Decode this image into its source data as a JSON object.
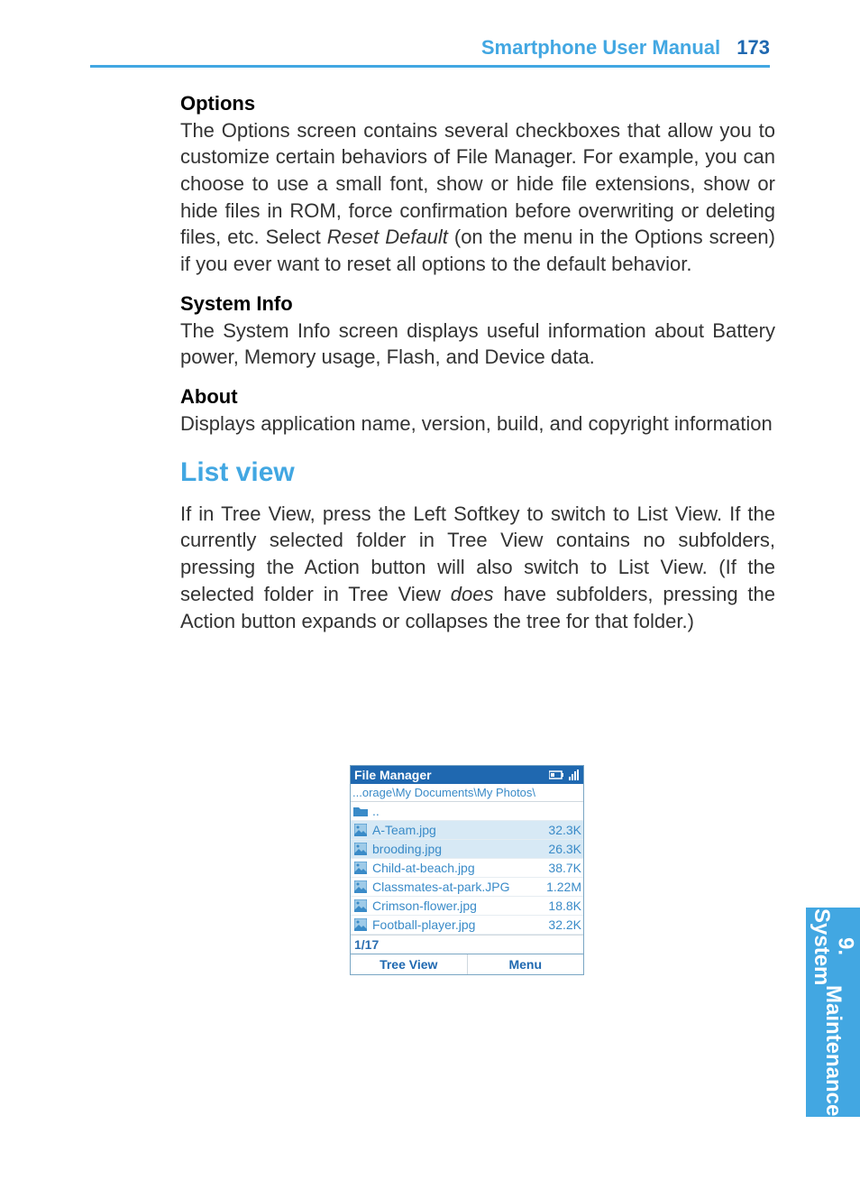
{
  "header": {
    "title": "Smartphone User Manual",
    "page": "173"
  },
  "sections": {
    "options": {
      "title": "Options",
      "body_a": "The Options screen contains several checkboxes that allow you to customize certain behaviors of File Manager.  For example, you can choose to use a small font, show or hide file extensions, show or hide files in ROM, force confirmation before overwriting or deleting files, etc.  Select ",
      "body_em": "Reset Default",
      "body_b": " (on the menu in the Options screen) if you ever want to reset all options to the default behavior."
    },
    "sysinfo": {
      "title": "System Info",
      "body": "The System Info screen displays useful information about Battery power, Memory usage, Flash, and Device data."
    },
    "about": {
      "title": "About",
      "body": "Displays application name, version, build, and copyright information"
    },
    "listview": {
      "heading": "List view",
      "body_a": "If in Tree View, press the Left Softkey to switch to List View.  If the currently selected folder in Tree View contains no subfolders, pressing the Action button will also switch to List View.  (If the selected folder in Tree View ",
      "body_em": "does",
      "body_b": " have subfolders, pressing the Action button expands or collapses the tree for that folder.)"
    }
  },
  "phone": {
    "title": "File Manager",
    "path": "...orage\\My Documents\\My Photos\\",
    "updir": "..",
    "files": [
      {
        "name": "A-Team.jpg",
        "size": "32.3K"
      },
      {
        "name": "brooding.jpg",
        "size": "26.3K"
      },
      {
        "name": "Child-at-beach.jpg",
        "size": "38.7K"
      },
      {
        "name": "Classmates-at-park.JPG",
        "size": "1.22M"
      },
      {
        "name": "Crimson-flower.jpg",
        "size": "18.8K"
      },
      {
        "name": "Football-player.jpg",
        "size": "32.2K"
      }
    ],
    "counter": "1/17",
    "softkeys": {
      "left": "Tree View",
      "right": "Menu"
    }
  },
  "tab": {
    "chapter": "9.  System",
    "name": "Maintenance"
  }
}
